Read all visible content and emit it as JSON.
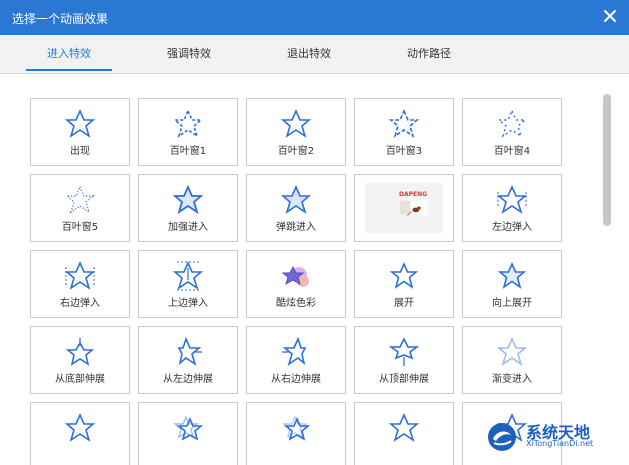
{
  "titlebar": {
    "title": "选择一个动画效果"
  },
  "tabs": [
    {
      "label": "进入特效"
    },
    {
      "label": "强调特效"
    },
    {
      "label": "退出特效"
    },
    {
      "label": "动作路径"
    }
  ],
  "effects": [
    {
      "label": "出现"
    },
    {
      "label": "百叶窗1"
    },
    {
      "label": "百叶窗2"
    },
    {
      "label": "百叶窗3"
    },
    {
      "label": "百叶窗4"
    },
    {
      "label": "百叶窗5"
    },
    {
      "label": "加强进入"
    },
    {
      "label": "弹跳进入"
    },
    {
      "label": ""
    },
    {
      "label": "左边弹入"
    },
    {
      "label": "右边弹入"
    },
    {
      "label": "上边弹入"
    },
    {
      "label": "酷炫色彩"
    },
    {
      "label": "展开"
    },
    {
      "label": "向上展开"
    },
    {
      "label": "从底部伸展"
    },
    {
      "label": "从左边伸展"
    },
    {
      "label": "从右边伸展"
    },
    {
      "label": "从顶部伸展"
    },
    {
      "label": "渐变进入"
    },
    {
      "label": ""
    },
    {
      "label": ""
    },
    {
      "label": ""
    },
    {
      "label": ""
    },
    {
      "label": ""
    }
  ],
  "thumbnail": {
    "caption": "DAPENG"
  },
  "watermark": {
    "line1": "系统天地",
    "line2": "XiTongTianDi.net"
  },
  "colors": {
    "titlebar": "#2a78d4",
    "star": "#2d6fd6"
  }
}
